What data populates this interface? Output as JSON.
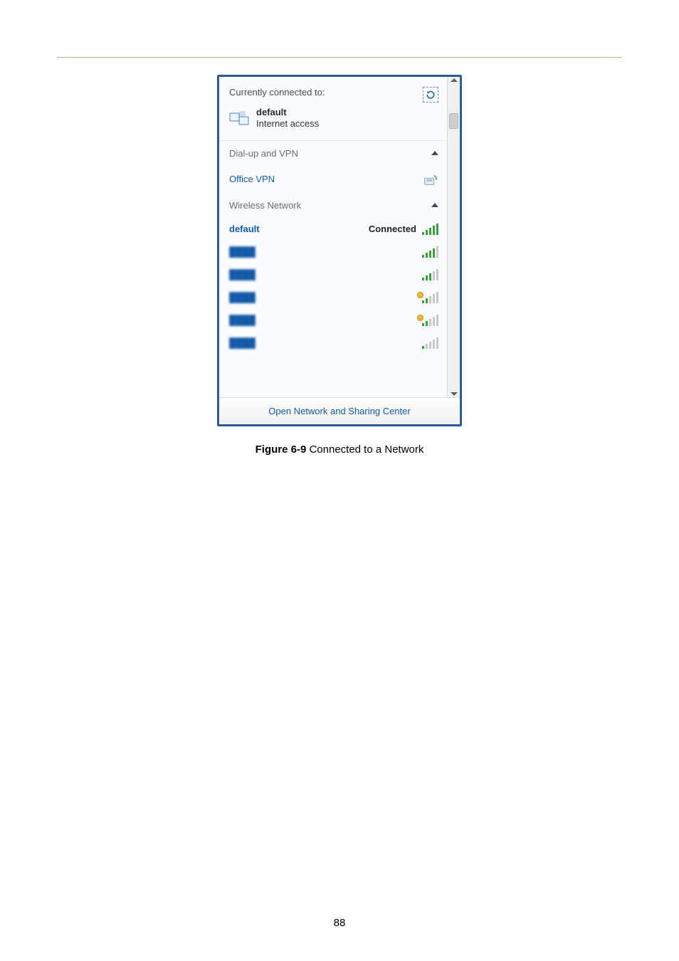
{
  "page_number": "88",
  "caption": {
    "label": "Figure 6-9",
    "text": " Connected to a Network"
  },
  "flyout": {
    "currently_connected_label": "Currently connected to:",
    "connected_network": {
      "name": "default",
      "status": "Internet access"
    },
    "sections": {
      "dialup_vpn": "Dial-up and VPN",
      "wireless": "Wireless Network"
    },
    "vpn_item": {
      "name": "Office VPN"
    },
    "wifi_items": [
      {
        "name": "default",
        "status": "Connected",
        "bars": 5,
        "locked": false,
        "obscured": false
      },
      {
        "name": "network-2",
        "status": "",
        "bars": 4,
        "locked": false,
        "obscured": true
      },
      {
        "name": "network-3",
        "status": "",
        "bars": 3,
        "locked": false,
        "obscured": true
      },
      {
        "name": "network-4",
        "status": "",
        "bars": 2,
        "locked": true,
        "obscured": true
      },
      {
        "name": "network-5",
        "status": "",
        "bars": 2,
        "locked": true,
        "obscured": true
      },
      {
        "name": "network-6",
        "status": "",
        "bars": 1,
        "locked": false,
        "obscured": true
      }
    ],
    "footer_link": "Open Network and Sharing Center"
  }
}
